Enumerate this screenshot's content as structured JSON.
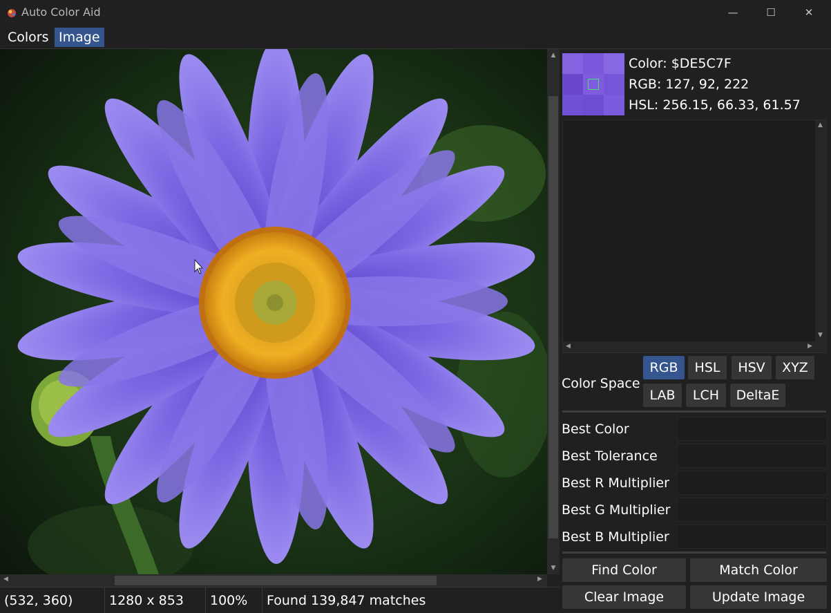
{
  "window": {
    "title": "Auto Color Aid",
    "minimize_glyph": "—",
    "maximize_glyph": "☐",
    "close_glyph": "✕"
  },
  "menu": {
    "items": [
      {
        "label": "Colors",
        "active": false
      },
      {
        "label": "Image",
        "active": true
      }
    ]
  },
  "status": {
    "cursor_pos": "(532, 360)",
    "image_size": "1280 x 853",
    "zoom": "100%",
    "message": "Found 139,847 matches"
  },
  "color_info": {
    "color_line": "Color: $DE5C7F",
    "rgb_line": "RGB: 127, 92, 222",
    "hsl_line": "HSL: 256.15, 66.33, 61.57"
  },
  "color_space": {
    "label": "Color Space",
    "options": [
      "RGB",
      "HSL",
      "HSV",
      "XYZ",
      "LAB",
      "LCH",
      "DeltaE"
    ],
    "selected": "RGB"
  },
  "best": {
    "color_label": "Best Color",
    "tolerance_label": "Best Tolerance",
    "r_label": "Best R Multiplier",
    "g_label": "Best G Multiplier",
    "b_label": "Best B Multiplier"
  },
  "actions": {
    "find": "Find Color",
    "match": "Match Color",
    "clear": "Clear Image",
    "update": "Update Image"
  },
  "colors": {
    "accent": "#34558e",
    "background": "#202020",
    "picked_color": "#7f5cde",
    "petal": "#7a66e0",
    "center": "#e8a020"
  },
  "icons": {
    "app": "color-drop-icon",
    "cursor": "mouse-pointer-icon"
  }
}
